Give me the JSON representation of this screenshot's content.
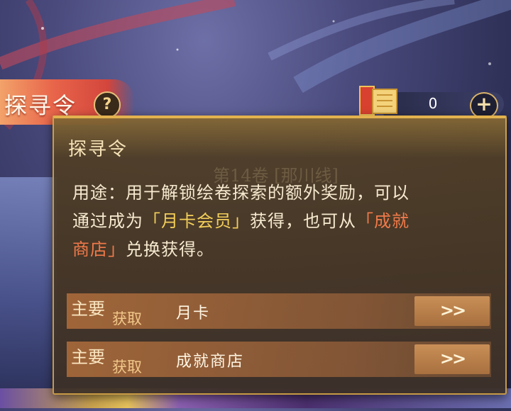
{
  "header": {
    "title": "探寻令",
    "help_label": "?",
    "resource_count": "0",
    "add_label": "+"
  },
  "panel": {
    "title": "探寻令",
    "background_text": "第14卷 [那川线]",
    "description": {
      "line1": "用途：用于解锁绘卷探索的额外奖励，可以",
      "line2_pre": "通过成为",
      "line2_hl1": "「月卡会员」",
      "line2_mid": "获得，也可从",
      "line2_hl2": "「成就",
      "line3_hl2": "商店」",
      "line3_post": "兑换获得。"
    },
    "sources": [
      {
        "tag_main": "主要",
        "tag_sub": "获取",
        "label": "月卡",
        "go_label": ">>"
      },
      {
        "tag_main": "主要",
        "tag_sub": "获取",
        "label": "成就商店",
        "go_label": ">>"
      }
    ]
  },
  "colors": {
    "highlight_yellow": "#f3cf5a",
    "highlight_red": "#f07a4a",
    "panel_border": "#c79a45",
    "title_banner": "#d3463c"
  },
  "icons": [
    "help-icon",
    "ticket-icon",
    "plus-icon",
    "double-chevron-right-icon"
  ]
}
